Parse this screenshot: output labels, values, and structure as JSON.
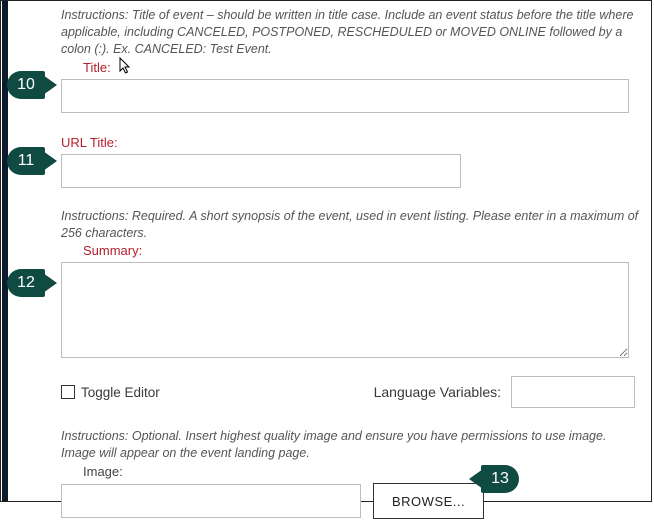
{
  "callouts": {
    "c10": "10",
    "c11": "11",
    "c12": "12",
    "c13": "13"
  },
  "title_section": {
    "instructions": "Instructions: Title of event – should be written in title case. Include an event status before the title where applicable, including CANCELED, POSTPONED, RESCHEDULED or MOVED ONLINE followed by a colon (:). Ex. CANCELED: Test Event.",
    "label": "Title:",
    "value": ""
  },
  "url_title_section": {
    "label": "URL Title:",
    "value": ""
  },
  "summary_section": {
    "instructions": "Instructions: Required. A short synopsis of the event, used in event listing. Please enter in a maximum of 256 characters.",
    "label": "Summary:",
    "value": ""
  },
  "toggle_editor": {
    "label": "Toggle Editor",
    "checked": false
  },
  "language_variables": {
    "label": "Language Variables:",
    "value": ""
  },
  "image_section": {
    "instructions": "Instructions: Optional. Insert highest quality image and ensure you have permissions to use image. Image will appear on the event landing page.",
    "label": "Image:",
    "value": "",
    "browse_label": "BROWSE..."
  }
}
